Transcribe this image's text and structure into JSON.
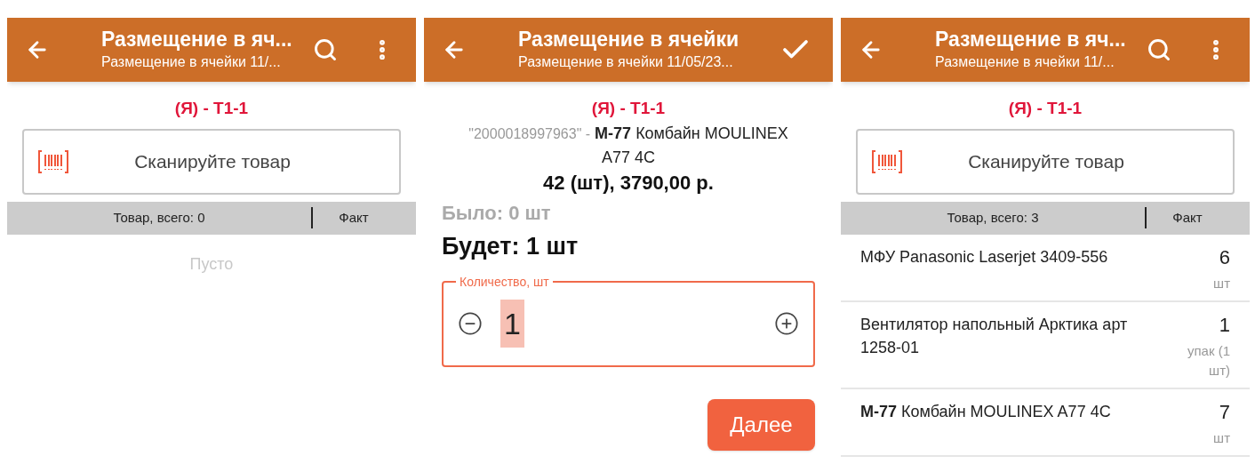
{
  "screens": [
    {
      "kind": "list",
      "title": "Размещение в яч...",
      "subtitle": "Размещение в ячейки 11/...",
      "actions": [
        {
          "kind": "search"
        },
        {
          "kind": "more"
        }
      ],
      "cell": "(Я) - Т1-1",
      "scan_placeholder": "Сканируйте товар",
      "columns": [
        "Товар, всего: 0",
        "Факт"
      ],
      "empty": "Пусто"
    },
    {
      "kind": "quantity",
      "title": "Размещение в ячейки",
      "subtitle": "Размещение в ячейки 11/05/23...",
      "actions": [
        {
          "kind": "check"
        }
      ],
      "cell": "(Я) - Т1-1",
      "barcode": "\"2000018997963\" -",
      "product": "**М-77** Комбайн MOULINEX A77 4C",
      "price": "42 (шт), 3790,00 р.",
      "was": "Было: 0 шт",
      "will_be": "Будет: 1 шт",
      "quantity_label": "Количество, шт",
      "quantity_value": "1",
      "next_button": "Далее"
    },
    {
      "kind": "list",
      "title": "Размещение в яч...",
      "subtitle": "Размещение в ячейки 11/...",
      "actions": [
        {
          "kind": "search"
        },
        {
          "kind": "more"
        }
      ],
      "cell": "(Я) - Т1-1",
      "scan_placeholder": "Сканируйте товар",
      "columns": [
        "Товар, всего: 3",
        "Факт"
      ],
      "rows": [
        {
          "name": "МФУ Panasonic Laserjet 3409-556",
          "qty": "6",
          "unit": "шт"
        },
        {
          "name": "Вентилятор напольный Арктика арт 1258-01",
          "qty": "1",
          "unit": "упак (1 шт)"
        },
        {
          "name": "**М-77** Комбайн MOULINEX A77 4C",
          "qty": "7",
          "unit": "шт"
        }
      ]
    }
  ]
}
